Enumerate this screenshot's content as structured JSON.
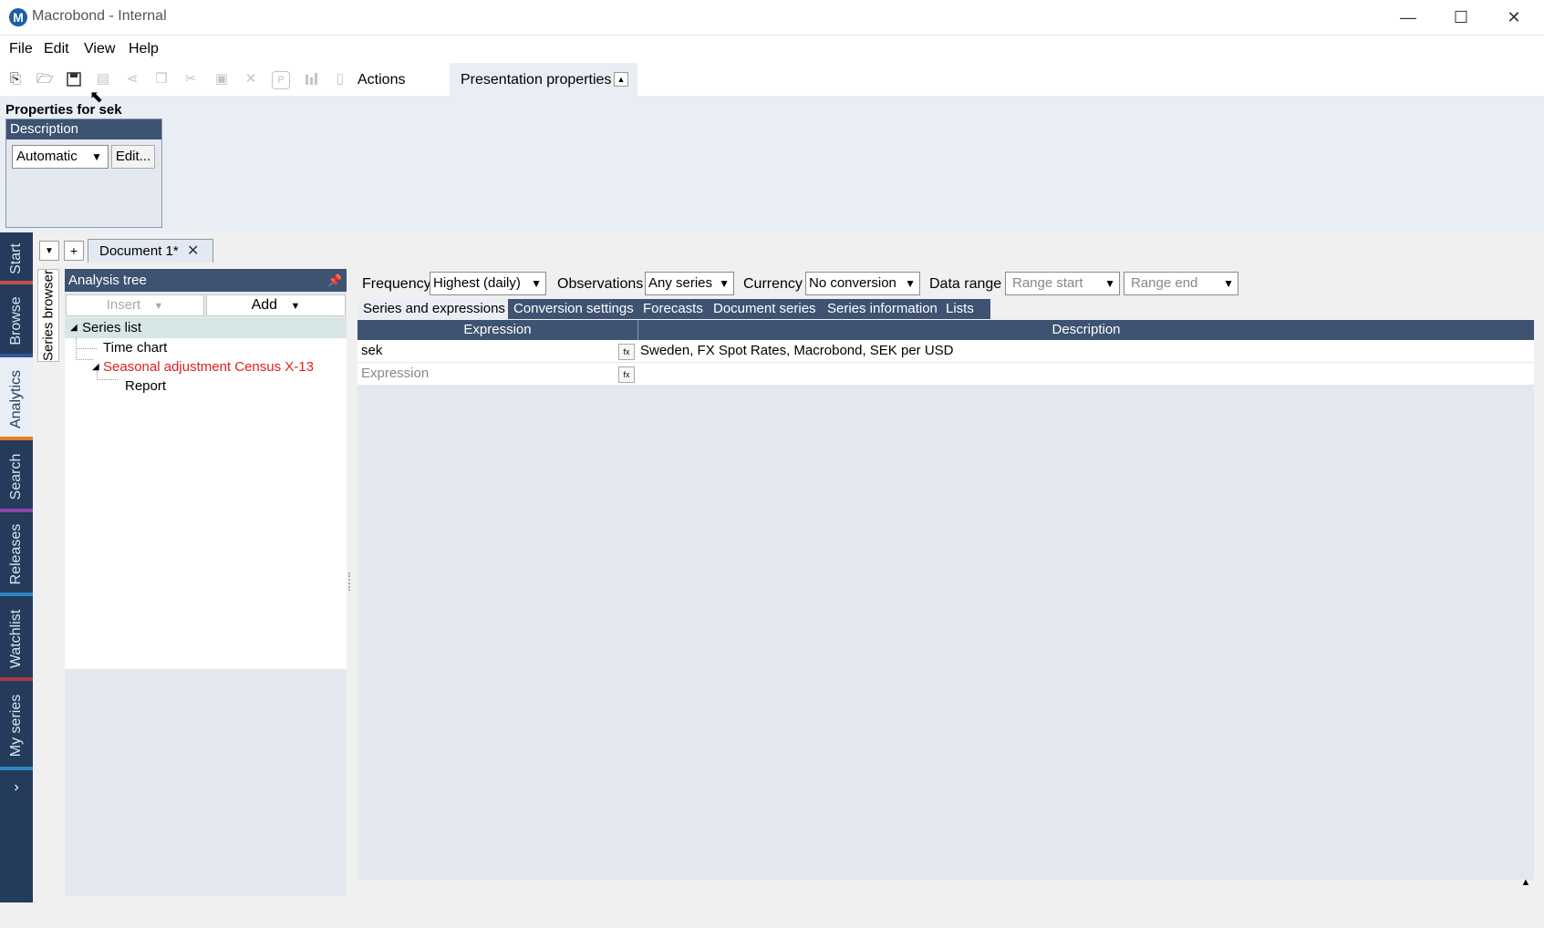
{
  "window": {
    "title": "Macrobond - Internal",
    "logo_letter": "M",
    "controls": {
      "minimize": "—",
      "maximize": "☐",
      "close": "✕"
    }
  },
  "menu": [
    "File",
    "Edit",
    "View",
    "Help"
  ],
  "toolbar": {
    "icons": [
      "new-document-icon",
      "open-folder-icon",
      "save-icon",
      "print-icon",
      "share-icon",
      "copy-icon",
      "cut-icon",
      "paste-icon",
      "delete-icon",
      "presentation-icon",
      "chart-icon",
      "scrollbar-icon"
    ],
    "actions_label": "Actions",
    "presentation_label": "Presentation properties"
  },
  "properties": {
    "title": "Properties for sek",
    "section": "Description",
    "description_mode": "Automatic",
    "edit_label": "Edit..."
  },
  "leftnav": {
    "tabs": [
      {
        "label": "Start",
        "accent": "#c0504d"
      },
      {
        "label": "Browse",
        "accent": "#2f5597"
      },
      {
        "label": "Analytics",
        "accent": "#e67e22",
        "active": true
      },
      {
        "label": "Search",
        "accent": "#8e44ad"
      },
      {
        "label": "Releases",
        "accent": "#2e86c1"
      },
      {
        "label": "Watchlist",
        "accent": "#b03a48"
      },
      {
        "label": "My series",
        "accent": "#2e86c1"
      }
    ],
    "more": "›"
  },
  "document": {
    "tab_label": "Document 1*",
    "close": "✕",
    "add": "+",
    "dropdown": "▼"
  },
  "series_browser": {
    "label": "Series browser"
  },
  "analysis_tree": {
    "title": "Analysis tree",
    "insert_label": "Insert",
    "add_label": "Add",
    "nodes": {
      "series_list": "Series list",
      "time_chart": "Time chart",
      "seasonal": "Seasonal adjustment Census X-13",
      "report": "Report"
    }
  },
  "filters": {
    "frequency_label": "Frequency",
    "frequency_value": "Highest (daily)",
    "observations_label": "Observations",
    "observations_value": "Any series",
    "currency_label": "Currency",
    "currency_value": "No conversion",
    "data_range_label": "Data range",
    "range_start_placeholder": "Range start",
    "range_end_placeholder": "Range end"
  },
  "subtabs": [
    "Series and expressions",
    "Conversion settings",
    "Forecasts",
    "Document series",
    "Series information",
    "Lists"
  ],
  "grid": {
    "headers": {
      "expression": "Expression",
      "description": "Description"
    },
    "rows": [
      {
        "expression": "sek",
        "description": "Sweden, FX Spot Rates, Macrobond, SEK per USD"
      }
    ],
    "new_row_placeholder": "Expression",
    "fx_label": "fx"
  }
}
